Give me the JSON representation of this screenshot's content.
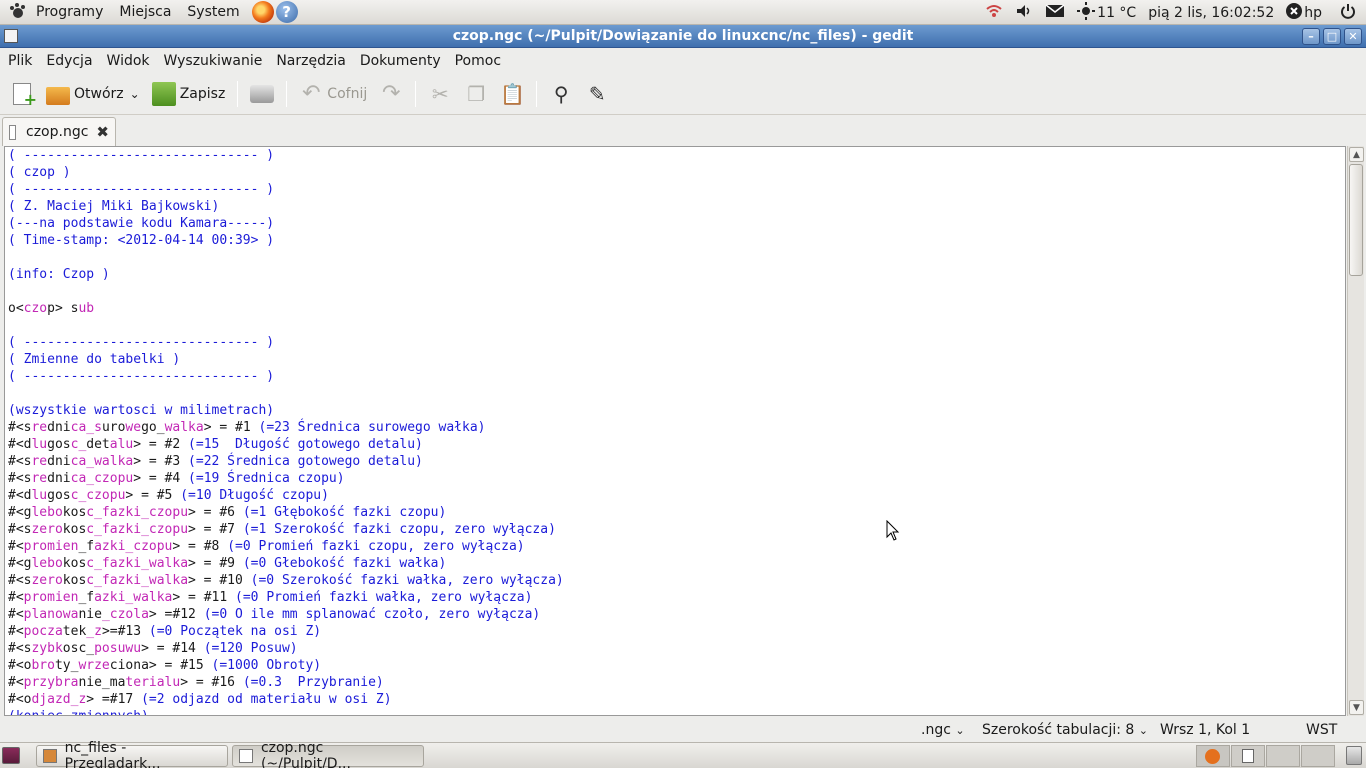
{
  "top_panel": {
    "menus": [
      "Programy",
      "Miejsca",
      "System"
    ],
    "weather": "11 °C",
    "clock": "pią  2 lis, 16:02:52",
    "user": "hp"
  },
  "window": {
    "title": "czop.ngc (~/Pulpit/Dowiązanie do linuxcnc/nc_files) - gedit"
  },
  "menubar": [
    "Plik",
    "Edycja",
    "Widok",
    "Wyszukiwanie",
    "Narzędzia",
    "Dokumenty",
    "Pomoc"
  ],
  "toolbar": {
    "open_label": "Otwórz",
    "save_label": "Zapisz",
    "undo_label": "Cofnij"
  },
  "tab": {
    "label": "czop.ngc"
  },
  "code_lines": [
    [
      {
        "t": "( ------------------------------ )",
        "c": "c"
      }
    ],
    [
      {
        "t": "( czop )",
        "c": "c"
      }
    ],
    [
      {
        "t": "( ------------------------------ )",
        "c": "c"
      }
    ],
    [
      {
        "t": "( Z. Maciej Miki Bajkowski)",
        "c": "c"
      }
    ],
    [
      {
        "t": "(---na podstawie kodu Kamara-----)",
        "c": "c"
      }
    ],
    [
      {
        "t": "( Time-stamp: <2012-04-14 00:39> )",
        "c": "c"
      }
    ],
    [
      {
        "t": "",
        "c": ""
      }
    ],
    [
      {
        "t": "(info: Czop )",
        "c": "c"
      }
    ],
    [
      {
        "t": "",
        "c": ""
      }
    ],
    [
      {
        "t": "o<",
        "c": ""
      },
      {
        "t": "czo",
        "c": "k"
      },
      {
        "t": "p> ",
        "c": ""
      },
      {
        "t": "s",
        "c": ""
      },
      {
        "t": "ub",
        "c": "k"
      }
    ],
    [
      {
        "t": "",
        "c": ""
      }
    ],
    [
      {
        "t": "( ------------------------------ )",
        "c": "c"
      }
    ],
    [
      {
        "t": "( Zmienne do tabelki )",
        "c": "c"
      }
    ],
    [
      {
        "t": "( ------------------------------ )",
        "c": "c"
      }
    ],
    [
      {
        "t": "",
        "c": ""
      }
    ],
    [
      {
        "t": "(wszystkie wartosci w milimetrach)",
        "c": "c"
      }
    ],
    [
      {
        "t": "#<s",
        "c": ""
      },
      {
        "t": "re",
        "c": "k"
      },
      {
        "t": "dni",
        "c": ""
      },
      {
        "t": "ca_s",
        "c": "k"
      },
      {
        "t": "uro",
        "c": ""
      },
      {
        "t": "we",
        "c": "k"
      },
      {
        "t": "go_",
        "c": ""
      },
      {
        "t": "walka",
        "c": "k"
      },
      {
        "t": "> = #1 ",
        "c": ""
      },
      {
        "t": "(=23 Średnica surowego wałka)",
        "c": "c"
      }
    ],
    [
      {
        "t": "#<d",
        "c": ""
      },
      {
        "t": "lu",
        "c": "k"
      },
      {
        "t": "gos",
        "c": ""
      },
      {
        "t": "c_",
        "c": "k"
      },
      {
        "t": "det",
        "c": ""
      },
      {
        "t": "alu",
        "c": "k"
      },
      {
        "t": "> = #2 ",
        "c": ""
      },
      {
        "t": "(=15  Długość gotowego detalu)",
        "c": "c"
      }
    ],
    [
      {
        "t": "#<s",
        "c": ""
      },
      {
        "t": "re",
        "c": "k"
      },
      {
        "t": "dni",
        "c": ""
      },
      {
        "t": "ca_walka",
        "c": "k"
      },
      {
        "t": "> = #3 ",
        "c": ""
      },
      {
        "t": "(=22 Średnica gotowego detalu)",
        "c": "c"
      }
    ],
    [
      {
        "t": "#<s",
        "c": ""
      },
      {
        "t": "re",
        "c": "k"
      },
      {
        "t": "dni",
        "c": ""
      },
      {
        "t": "ca_czopu",
        "c": "k"
      },
      {
        "t": "> = #4 ",
        "c": ""
      },
      {
        "t": "(=19 Średnica czopu)",
        "c": "c"
      }
    ],
    [
      {
        "t": "#<d",
        "c": ""
      },
      {
        "t": "lu",
        "c": "k"
      },
      {
        "t": "gos",
        "c": ""
      },
      {
        "t": "c_czopu",
        "c": "k"
      },
      {
        "t": "> = #5 ",
        "c": ""
      },
      {
        "t": "(=10 Długość czopu)",
        "c": "c"
      }
    ],
    [
      {
        "t": "#<g",
        "c": ""
      },
      {
        "t": "lebo",
        "c": "k"
      },
      {
        "t": "kos",
        "c": ""
      },
      {
        "t": "c_fazki_czopu",
        "c": "k"
      },
      {
        "t": "> = #6 ",
        "c": ""
      },
      {
        "t": "(=1 Głębokość fazki czopu)",
        "c": "c"
      }
    ],
    [
      {
        "t": "#<s",
        "c": ""
      },
      {
        "t": "zero",
        "c": "k"
      },
      {
        "t": "kos",
        "c": ""
      },
      {
        "t": "c_fazki_czopu",
        "c": "k"
      },
      {
        "t": "> = #7 ",
        "c": ""
      },
      {
        "t": "(=1 Szerokość fazki czopu, zero wyłącza)",
        "c": "c"
      }
    ],
    [
      {
        "t": "#<",
        "c": ""
      },
      {
        "t": "promien",
        "c": "k"
      },
      {
        "t": "_f",
        "c": ""
      },
      {
        "t": "azki_czopu",
        "c": "k"
      },
      {
        "t": "> = #8 ",
        "c": ""
      },
      {
        "t": "(=0 Promień fazki czopu, zero wyłącza)",
        "c": "c"
      }
    ],
    [
      {
        "t": "#<g",
        "c": ""
      },
      {
        "t": "lebo",
        "c": "k"
      },
      {
        "t": "kos",
        "c": ""
      },
      {
        "t": "c_fazki_walka",
        "c": "k"
      },
      {
        "t": "> = #9 ",
        "c": ""
      },
      {
        "t": "(=0 Głebokość fazki wałka)",
        "c": "c"
      }
    ],
    [
      {
        "t": "#<s",
        "c": ""
      },
      {
        "t": "zero",
        "c": "k"
      },
      {
        "t": "kos",
        "c": ""
      },
      {
        "t": "c_fazki_walka",
        "c": "k"
      },
      {
        "t": "> = #10 ",
        "c": ""
      },
      {
        "t": "(=0 Szerokość fazki wałka, zero wyłącza)",
        "c": "c"
      }
    ],
    [
      {
        "t": "#<",
        "c": ""
      },
      {
        "t": "promien",
        "c": "k"
      },
      {
        "t": "_f",
        "c": ""
      },
      {
        "t": "azki_walka",
        "c": "k"
      },
      {
        "t": "> = #11 ",
        "c": ""
      },
      {
        "t": "(=0 Promień fazki wałka, zero wyłącza)",
        "c": "c"
      }
    ],
    [
      {
        "t": "#<",
        "c": ""
      },
      {
        "t": "planowa",
        "c": "k"
      },
      {
        "t": "nie",
        "c": ""
      },
      {
        "t": "_czola",
        "c": "k"
      },
      {
        "t": "> =#12 ",
        "c": ""
      },
      {
        "t": "(=0 O ile mm splanować czoło, zero wyłącza)",
        "c": "c"
      }
    ],
    [
      {
        "t": "#<",
        "c": ""
      },
      {
        "t": "pocza",
        "c": "k"
      },
      {
        "t": "tek",
        "c": ""
      },
      {
        "t": "_z",
        "c": "k"
      },
      {
        "t": ">=#13 ",
        "c": ""
      },
      {
        "t": "(=0 Początek na osi Z)",
        "c": "c"
      }
    ],
    [
      {
        "t": "#<s",
        "c": ""
      },
      {
        "t": "zybk",
        "c": "k"
      },
      {
        "t": "osc_",
        "c": ""
      },
      {
        "t": "posuwu",
        "c": "k"
      },
      {
        "t": "> = #14 ",
        "c": ""
      },
      {
        "t": "(=120 Posuw)",
        "c": "c"
      }
    ],
    [
      {
        "t": "#<o",
        "c": ""
      },
      {
        "t": "bro",
        "c": "k"
      },
      {
        "t": "ty_",
        "c": ""
      },
      {
        "t": "wrze",
        "c": "k"
      },
      {
        "t": "ciona",
        "c": ""
      },
      {
        "t": "> = #15 ",
        "c": ""
      },
      {
        "t": "(=1000 Obroty)",
        "c": "c"
      }
    ],
    [
      {
        "t": "#<",
        "c": ""
      },
      {
        "t": "przybra",
        "c": "k"
      },
      {
        "t": "nie_ma",
        "c": ""
      },
      {
        "t": "ter",
        "c": "k"
      },
      {
        "t": "ialu",
        "c": "k"
      },
      {
        "t": "> = #16 ",
        "c": ""
      },
      {
        "t": "(=0.3  Przybranie)",
        "c": "c"
      }
    ],
    [
      {
        "t": "#<o",
        "c": ""
      },
      {
        "t": "dja",
        "c": "k"
      },
      {
        "t": "zd_z",
        "c": "k"
      },
      {
        "t": "> =#17 ",
        "c": ""
      },
      {
        "t": "(=2 odjazd od materiału w osi Z)",
        "c": "c"
      }
    ],
    [
      {
        "t": "(koniec zmiennych)",
        "c": "c"
      }
    ]
  ],
  "statusbar": {
    "language": ".ngc",
    "tab_width": "Szerokość tabulacji: 8",
    "position": "Wrsz 1, Kol 1",
    "mode": "WST"
  },
  "taskbar": {
    "tasks": [
      "nc_files - Przeglądark...",
      "czop.ngc (~/Pulpit/D..."
    ]
  }
}
